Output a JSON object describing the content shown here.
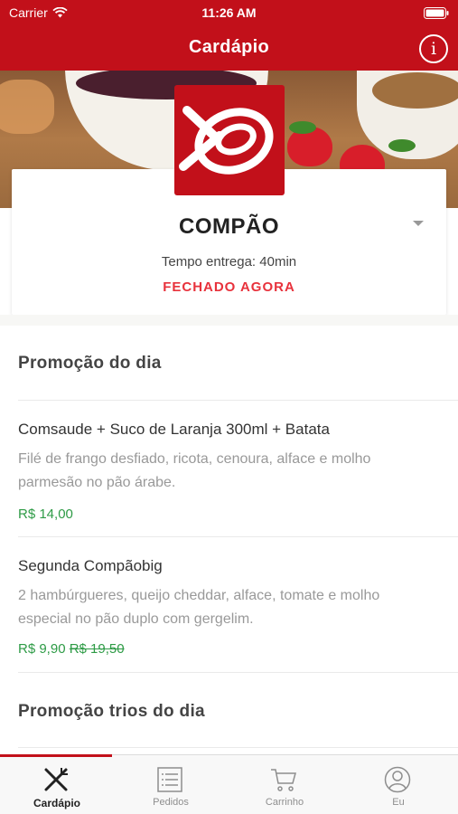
{
  "status_bar": {
    "carrier": "Carrier",
    "time": "11:26 AM"
  },
  "nav": {
    "title": "Cardápio",
    "info_label": "i"
  },
  "restaurant": {
    "name": "COMPÃO",
    "delivery_time": "Tempo entrega: 40min",
    "status": "FECHADO AGORA",
    "brand_color": "#c2101a",
    "status_color": "#e8323c"
  },
  "sections": [
    {
      "title": "Promoção do dia",
      "items": [
        {
          "name": "Comsaude + Suco de Laranja 300ml + Batata",
          "description": "Filé de frango desfiado, ricota, cenoura, alface e molho parmesão no pão árabe.",
          "price": "R$ 14,00"
        },
        {
          "name": "Segunda Compãobig",
          "description": "2 hambúrgueres, queijo cheddar, alface, tomate e molho especial no pão duplo com gergelim.",
          "price": "R$ 9,90",
          "old_price": "R$ 19,50"
        }
      ]
    },
    {
      "title": "Promoção trios do dia"
    }
  ],
  "tabs": [
    {
      "label": "Cardápio",
      "icon": "fork-knife-icon",
      "active": true
    },
    {
      "label": "Pedidos",
      "icon": "list-icon",
      "active": false
    },
    {
      "label": "Carrinho",
      "icon": "cart-icon",
      "active": false
    },
    {
      "label": "Eu",
      "icon": "user-icon",
      "active": false
    }
  ],
  "price_color": "#2e9b46"
}
